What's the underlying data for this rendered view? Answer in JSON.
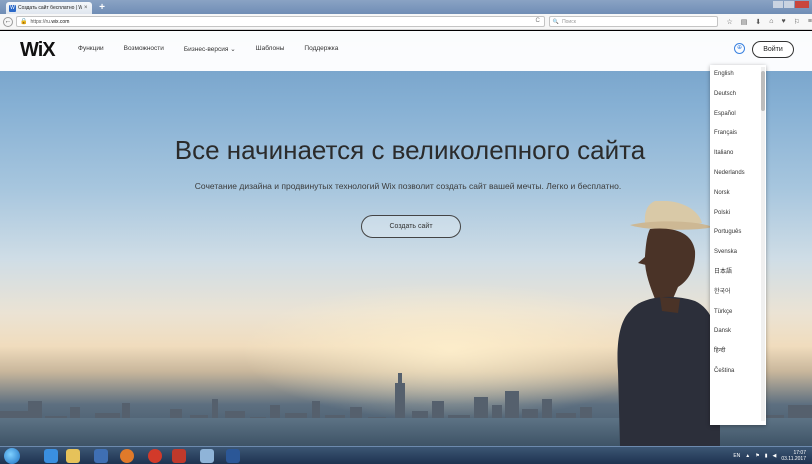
{
  "browser": {
    "tab_title": "Создать сайт бесплатно | W",
    "tab_close": "×",
    "new_tab": "+",
    "url_prefix": "https://ru.",
    "url_domain": "wix.com",
    "search_placeholder": "Поиск"
  },
  "site": {
    "logo": "WiX",
    "menu": [
      "Функции",
      "Возможности",
      "Бизнес-версия ⌄",
      "Шаблоны",
      "Поддержка"
    ],
    "login_label": "Войти"
  },
  "hero": {
    "title": "Все начинается с великолепного сайта",
    "subtitle": "Сочетание дизайна и продвинутых технологий Wix позволит создать сайт вашей мечты. Легко и бесплатно.",
    "cta_label": "Создать сайт"
  },
  "languages": [
    "English",
    "Deutsch",
    "Español",
    "Français",
    "Italiano",
    "Nederlands",
    "Norsk",
    "Polski",
    "Português",
    "Svenska",
    "日本語",
    "한국어",
    "Türkçe",
    "Dansk",
    "हिन्दी",
    "Čeština"
  ],
  "taskbar": {
    "lang": "EN",
    "time": "17:07",
    "date": "03.11.2017"
  },
  "colors": {
    "accent": "#3b82e0",
    "taskbar": "#1e3350"
  }
}
